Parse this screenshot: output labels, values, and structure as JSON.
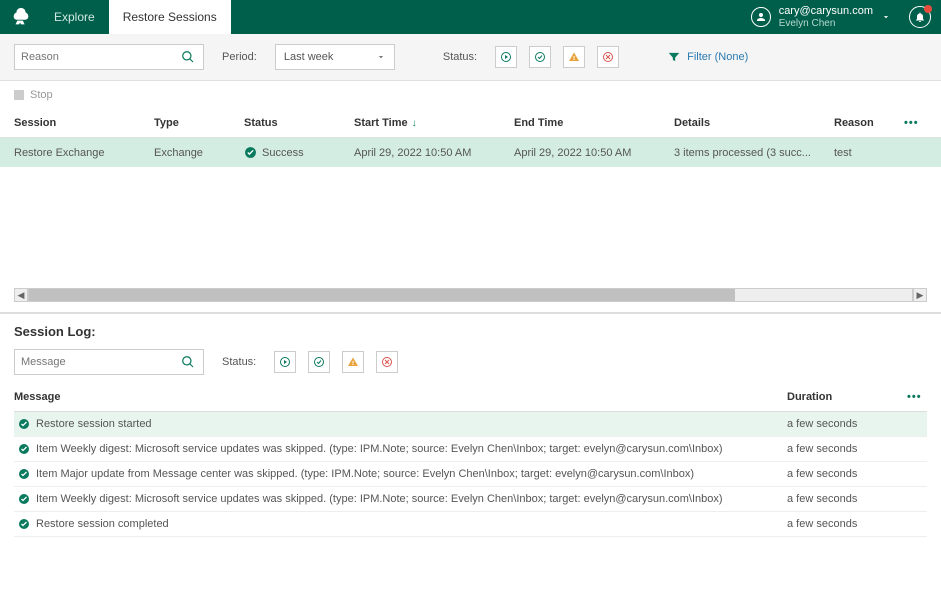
{
  "topbar": {
    "tabs": [
      {
        "label": "Explore"
      },
      {
        "label": "Restore Sessions"
      }
    ],
    "user_email": "cary@carysun.com",
    "user_name": "Evelyn Chen"
  },
  "toolbar": {
    "reason_placeholder": "Reason",
    "period_label": "Period:",
    "period_value": "Last week",
    "status_label": "Status:",
    "filter_label": "Filter (None)"
  },
  "stop_label": "Stop",
  "sessions": {
    "headers": {
      "session": "Session",
      "type": "Type",
      "status": "Status",
      "start": "Start Time",
      "end": "End Time",
      "details": "Details",
      "reason": "Reason"
    },
    "rows": [
      {
        "session": "Restore Exchange",
        "type": "Exchange",
        "status": "Success",
        "start": "April 29, 2022 10:50 AM",
        "end": "April 29, 2022 10:50 AM",
        "details": "3 items processed (3 succ...",
        "reason": "test"
      }
    ]
  },
  "session_log": {
    "title": "Session Log:",
    "message_placeholder": "Message",
    "status_label": "Status:",
    "headers": {
      "message": "Message",
      "duration": "Duration"
    },
    "rows": [
      {
        "msg": "Restore session started",
        "duration": "a few seconds",
        "highlight": true
      },
      {
        "msg": "Item Weekly digest: Microsoft service updates was skipped. (type: IPM.Note; source: Evelyn Chen\\Inbox; target: evelyn@carysun.com\\Inbox)",
        "duration": "a few seconds"
      },
      {
        "msg": "Item Major update from Message center was skipped. (type: IPM.Note; source: Evelyn Chen\\Inbox; target: evelyn@carysun.com\\Inbox)",
        "duration": "a few seconds"
      },
      {
        "msg": "Item Weekly digest: Microsoft service updates was skipped. (type: IPM.Note; source: Evelyn Chen\\Inbox; target: evelyn@carysun.com\\Inbox)",
        "duration": "a few seconds"
      },
      {
        "msg": "Restore session completed",
        "duration": "a few seconds"
      }
    ]
  }
}
